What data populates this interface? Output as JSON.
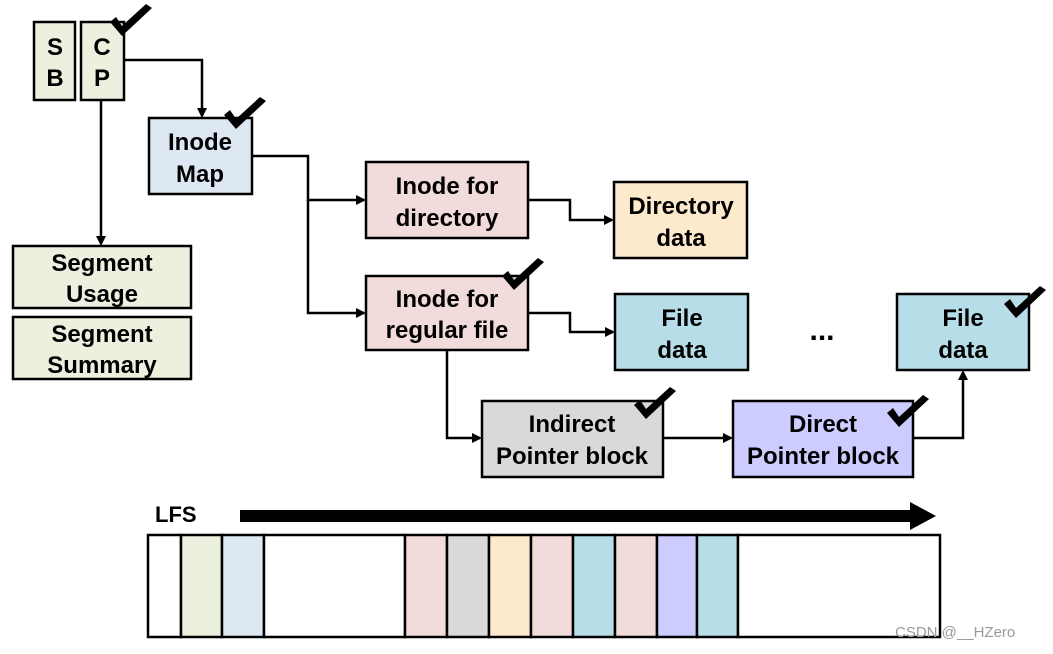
{
  "blocks": {
    "sb": {
      "line1": "S",
      "line2": "B",
      "color": "#ebf1de"
    },
    "cp": {
      "line1": "C",
      "line2": "P",
      "color": "#ebf1de"
    },
    "inode_map": {
      "line1": "Inode",
      "line2": "Map",
      "color": "#dee8f3"
    },
    "segment_usage": {
      "line1": "Segment",
      "line2": "Usage",
      "color": "#ebf1de"
    },
    "segment_summary": {
      "line1": "Segment",
      "line2": "Summary",
      "color": "#ebf1de"
    },
    "inode_dir": {
      "line1": "Inode for",
      "line2": "directory",
      "color": "#f2dcdb"
    },
    "dir_data": {
      "line1": "Directory",
      "line2": "data",
      "color": "#fde9cc"
    },
    "inode_file": {
      "line1": "Inode for",
      "line2": "regular file",
      "color": "#f2dcdb"
    },
    "file_data_1": {
      "line1": "File",
      "line2": "data",
      "color": "#b7dee8"
    },
    "file_data_2": {
      "line1": "File",
      "line2": "data",
      "color": "#b7dee8"
    },
    "indirect": {
      "line1": "Indirect",
      "line2": "Pointer block",
      "color": "#d9d9d9"
    },
    "direct": {
      "line1": "Direct",
      "line2": "Pointer block",
      "color": "#ccccff"
    }
  },
  "ellipsis": "...",
  "log": {
    "label": "LFS",
    "segments": [
      "#ffffff",
      "#ebf1de",
      "#dee8f3",
      "#ffffff",
      "#f2dcdb",
      "#d9d9d9",
      "#fde9cc",
      "#f2dcdb",
      "#b7dee8",
      "#f2dcdb",
      "#ccccff",
      "#b7dee8",
      "#ffffff"
    ]
  },
  "watermark": "CSDN @__HZero"
}
